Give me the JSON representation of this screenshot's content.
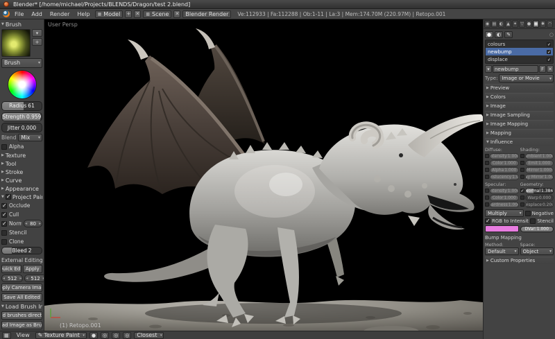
{
  "window": {
    "title": "Blender* [/home/michael/Projects/BLENDS/Dragon/test 2.blend]"
  },
  "icons": {
    "add": "+",
    "close": "✕",
    "browse": "▾",
    "fake_user": "F",
    "layout": "▦",
    "scene": "▩",
    "editor": "▦",
    "brush": "✎",
    "sphere": "●",
    "circle": "◎",
    "pin": "○",
    "up": "▴",
    "down": "▾"
  },
  "topbar": {
    "menus": [
      "File",
      "Add",
      "Render",
      "Help"
    ],
    "layout_name": "Model",
    "scene_name": "Scene",
    "engine": "Blender Render",
    "stats": "Ve:112933 | Fa:112288 | Ob:1-11 | La:3 | Mem:174.70M (220.97M) | Retopo.001"
  },
  "toolshelf": {
    "brush_panel_title": "Brush",
    "brush_selector_label": "Brush",
    "radius_label": "Radius",
    "radius_value": "61",
    "strength_label": "Strength",
    "strength_value": "0.959",
    "jitter_label": "Jitter",
    "jitter_value": "0.000",
    "blend_label": "Blend",
    "blend_value": "Mix",
    "alpha_label": "Alpha",
    "panels": [
      "Texture",
      "Tool",
      "Stroke",
      "Curve",
      "Appearance"
    ],
    "project_paint": {
      "title": "Project Paint",
      "occlude": "Occlude",
      "cull": "Cull",
      "normal": "Normal",
      "normal_value": "80",
      "stencil": "Stencil",
      "clone": "Clone",
      "bleed_label": "Bleed",
      "bleed_value": "2"
    },
    "external_editing": {
      "title": "External Editing",
      "quick_edit": "Quick Edit",
      "apply": "Apply",
      "res_x": "512",
      "res_y": "512",
      "apply_camera_image": "Apply Camera Image",
      "save_all_edited": "Save All Edited"
    },
    "load_brush_images": {
      "title": "Load Brush Images",
      "load_brushes_directory": "Load brushes directory",
      "load_image_as_brush": "Load Image as Brush"
    }
  },
  "viewport": {
    "view_label": "User Persp",
    "object_label": "(1) Retopo.001"
  },
  "view_header": {
    "view_menu": "View",
    "mode": "Texture Paint",
    "sampling": "Closest"
  },
  "properties": {
    "tabs": [
      {
        "id": "render",
        "glyph": "◉"
      },
      {
        "id": "scene",
        "glyph": "▤"
      },
      {
        "id": "world",
        "glyph": "◐"
      },
      {
        "id": "object",
        "glyph": "▲"
      },
      {
        "id": "modifiers",
        "glyph": "✦"
      },
      {
        "id": "object-data",
        "glyph": "▽"
      },
      {
        "id": "material",
        "glyph": "●"
      },
      {
        "id": "texture",
        "glyph": "▦"
      },
      {
        "id": "particles",
        "glyph": "✱"
      },
      {
        "id": "physics",
        "glyph": "◠"
      }
    ],
    "crumbs": [
      {
        "id": "material-textures",
        "glyph": "●"
      },
      {
        "id": "world-textures",
        "glyph": "◐"
      },
      {
        "id": "brush-textures",
        "glyph": "✎"
      }
    ],
    "slots": [
      {
        "name": "colours"
      },
      {
        "name": "newbump"
      },
      {
        "name": "displace"
      }
    ],
    "datablock_name": "newbump",
    "type_label": "Type:",
    "type_value": "Image or Movie",
    "panels": [
      "Preview",
      "Colors",
      "Image",
      "Image Sampling",
      "Image Mapping",
      "Mapping"
    ],
    "influence_title": "Influence",
    "influence": {
      "diffuse_label": "Diffuse:",
      "diffuse": [
        {
          "label": "Intensity",
          "value": "1.000"
        },
        {
          "label": "Color",
          "value": "1.000"
        },
        {
          "label": "Alpha",
          "value": "1.000"
        },
        {
          "label": "Translucency",
          "value": "1.000"
        }
      ],
      "shading_label": "Shading:",
      "shading": [
        {
          "label": "Ambient",
          "value": "1.000"
        },
        {
          "label": "Emit",
          "value": "1.000"
        },
        {
          "label": "Mirror",
          "value": "1.000"
        },
        {
          "label": "Ray Mirror",
          "value": "1.000"
        }
      ],
      "specular_label": "Specular:",
      "specular": [
        {
          "label": "Intensity",
          "value": "1.000"
        },
        {
          "label": "Color",
          "value": "1.000"
        },
        {
          "label": "Hardness",
          "value": "1.000"
        }
      ],
      "geometry_label": "Geometry:",
      "geometry": [
        {
          "label": "Normal",
          "value": "1.384"
        },
        {
          "label": "Warp",
          "value": "0.000"
        },
        {
          "label": "Displace",
          "value": "0.200"
        }
      ],
      "blend_value": "Multiply",
      "negative": "Negative",
      "rgb_to_intensity": "RGB to Intensity",
      "stencil": "Stencil",
      "dvar_label": "DVar:",
      "dvar_value": "1.000",
      "swatch_style": "background:#e87ce0",
      "bump_title": "Bump Mapping",
      "method_label": "Method:",
      "method_value": "Default",
      "space_label": "Space:",
      "space_value": "Object"
    },
    "custom_properties": "Custom Properties"
  },
  "colors": {
    "selection": "#4a6ba5",
    "swatch_pink": "#e87ce0"
  }
}
